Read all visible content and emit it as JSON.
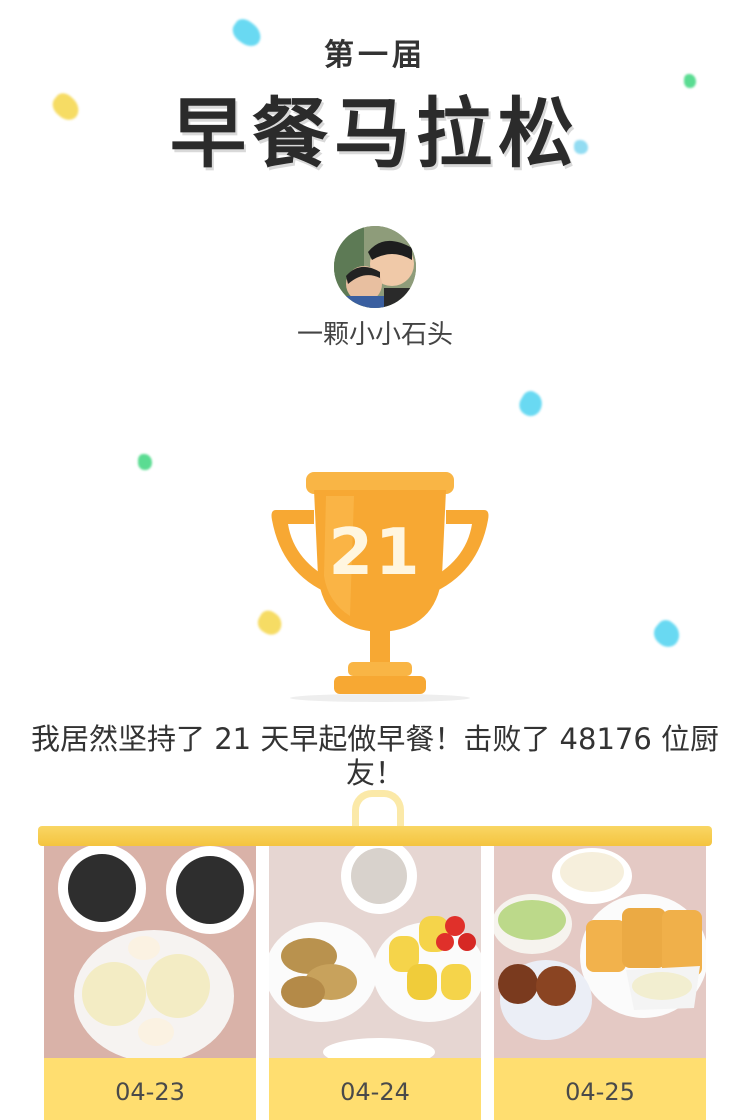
{
  "header": {
    "subtitle": "第一届",
    "title": "早餐马拉松"
  },
  "user": {
    "name": "一颗小小石头"
  },
  "trophy": {
    "days": "21"
  },
  "achievement": {
    "text": "我居然坚持了 21 天早起做早餐！击败了 48176 位厨友！"
  },
  "gallery": [
    {
      "date": "04-23"
    },
    {
      "date": "04-24"
    },
    {
      "date": "04-25"
    }
  ],
  "colors": {
    "accent": "#ffde70",
    "trophy": "#f7a833",
    "rod": "#f4c43f"
  }
}
